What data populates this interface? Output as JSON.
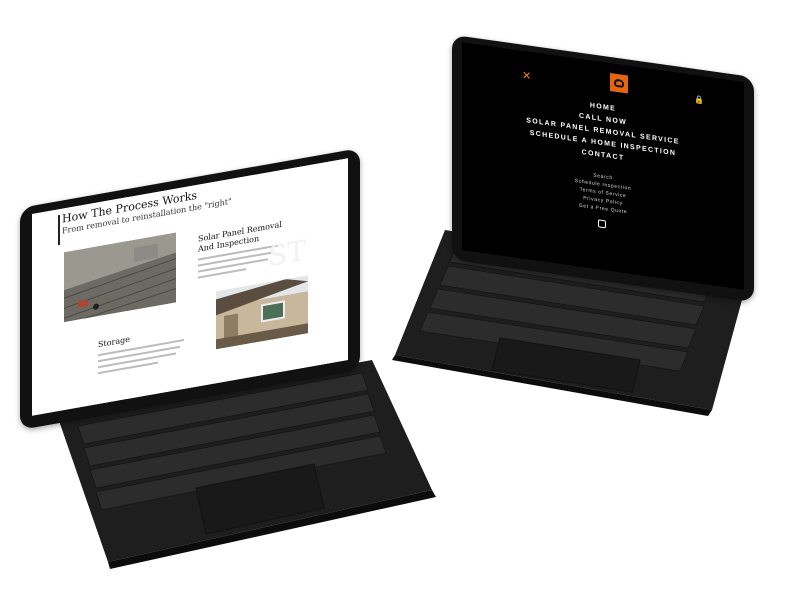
{
  "left_laptop": {
    "page_title": "How The Process Works",
    "page_subtitle": "From removal to reinstallation the \"right\"",
    "section_1_heading": "Solar Panel Removal And Inspection",
    "section_2_heading": "Storage",
    "ghost_text": "ST"
  },
  "right_laptop": {
    "close_label": "✕",
    "lock_label": "🔒",
    "main_menu": [
      "HOME",
      "CALL NOW",
      "SOLAR PANEL REMOVAL SERVICE",
      "SCHEDULE A HOME INSPECTION",
      "CONTACT"
    ],
    "sub_menu": [
      "Search",
      "Schedule Inspection",
      "Terms of Service",
      "Privacy Policy",
      "Get a Free Quote"
    ]
  },
  "colors": {
    "accent": "#ff7a00",
    "logo": "#e8650f",
    "device": "#111111"
  }
}
